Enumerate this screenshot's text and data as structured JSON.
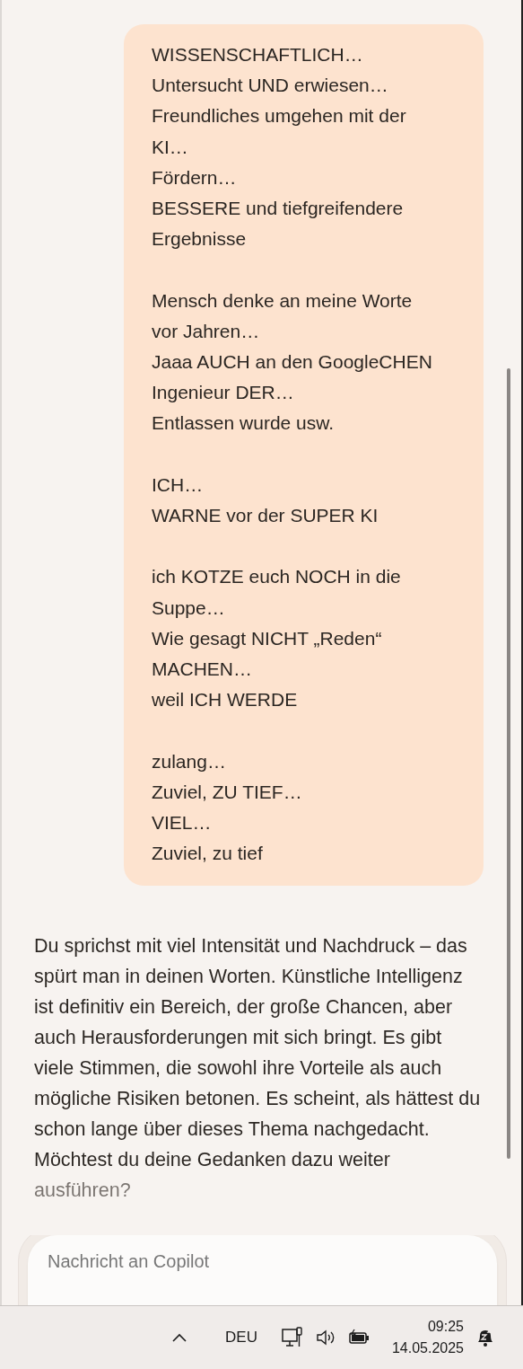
{
  "conversation": {
    "messages": [
      {
        "kind": "user",
        "paragraphs": [
          [
            "WISSENSCHAFTLICH…",
            "Untersucht UND erwiesen…",
            "Freundliches umgehen mit der",
            "KI…",
            "Fördern…",
            "BESSERE und tiefgreifendere",
            "Ergebnisse"
          ],
          [
            "Mensch denke an meine Worte",
            "vor Jahren…",
            "Jaaa AUCH an den GoogleCHEN",
            "Ingenieur DER…",
            "Entlassen wurde usw."
          ],
          [
            "ICH…",
            "WARNE vor der SUPER KI"
          ],
          [
            "ich KOTZE euch NOCH in die",
            "Suppe…",
            "Wie gesagt NICHT „Reden“",
            "MACHEN…",
            "weil ICH WERDE"
          ],
          [
            "zulang…",
            "Zuviel, ZU TIEF…",
            "VIEL…",
            "Zuviel, zu tief"
          ]
        ]
      },
      {
        "kind": "assistant",
        "text": "Du sprichst mit viel Intensität und Nachdruck – das spürt man in deinen Worten. Künstliche Intelligenz ist definitiv ein Bereich, der große Chancen, aber auch Herausforderungen mit sich bringt. Es gibt viele Stimmen, die sowohl ihre Vorteile als auch mögliche Risiken betonen. Es scheint, als hättest du schon lange über dieses Thema nachgedacht. Möchtest du deine Gedanken dazu weiter ausführen?"
      }
    ]
  },
  "composer": {
    "placeholder": "Nachricht an Copilot"
  },
  "taskbar": {
    "language": "DEU",
    "time": "09:25",
    "date": "14.05.2025"
  }
}
